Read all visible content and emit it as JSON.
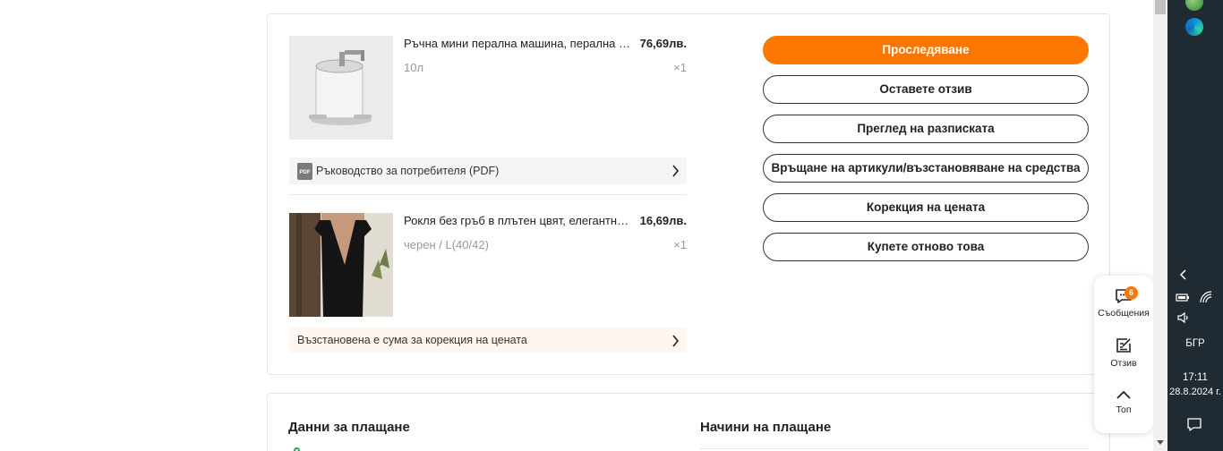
{
  "order": {
    "items": [
      {
        "title": "Ръчна мини перална машина, перална машина",
        "price": "76,69лв.",
        "variant": "10л",
        "qty": "×1"
      },
      {
        "title": "Рокля без гръб в плътен цвят, елегантна рокля",
        "price": "16,69лв.",
        "variant": "черен / L(40/42)",
        "qty": "×1"
      }
    ],
    "manual_label": "Ръководство за потребителя (PDF)",
    "pdf_icon_text": "PDF",
    "refund_label": "Възстановена е сума за корекция на цената",
    "actions": {
      "track": "Проследяване",
      "review": "Оставете отзив",
      "receipt": "Преглед на разписката",
      "return": "Връщане на артикули/възстановяване на средства",
      "price_adjust": "Корекция на цената",
      "buy_again": "Купете отново това"
    }
  },
  "payment": {
    "details_title": "Данни за плащане",
    "methods_title": "Начини на плащане"
  },
  "side_panel": {
    "messages_label": "Съобщения",
    "messages_badge": "6",
    "feedback_label": "Отзив",
    "top_label": "Топ"
  },
  "taskbar": {
    "language": "БГР",
    "time": "17:11",
    "date": "28.8.2024 г."
  },
  "colors": {
    "accent": "#fb7701",
    "refund_bg": "#fff6ef",
    "taskbar_bg": "#1f2a33"
  }
}
